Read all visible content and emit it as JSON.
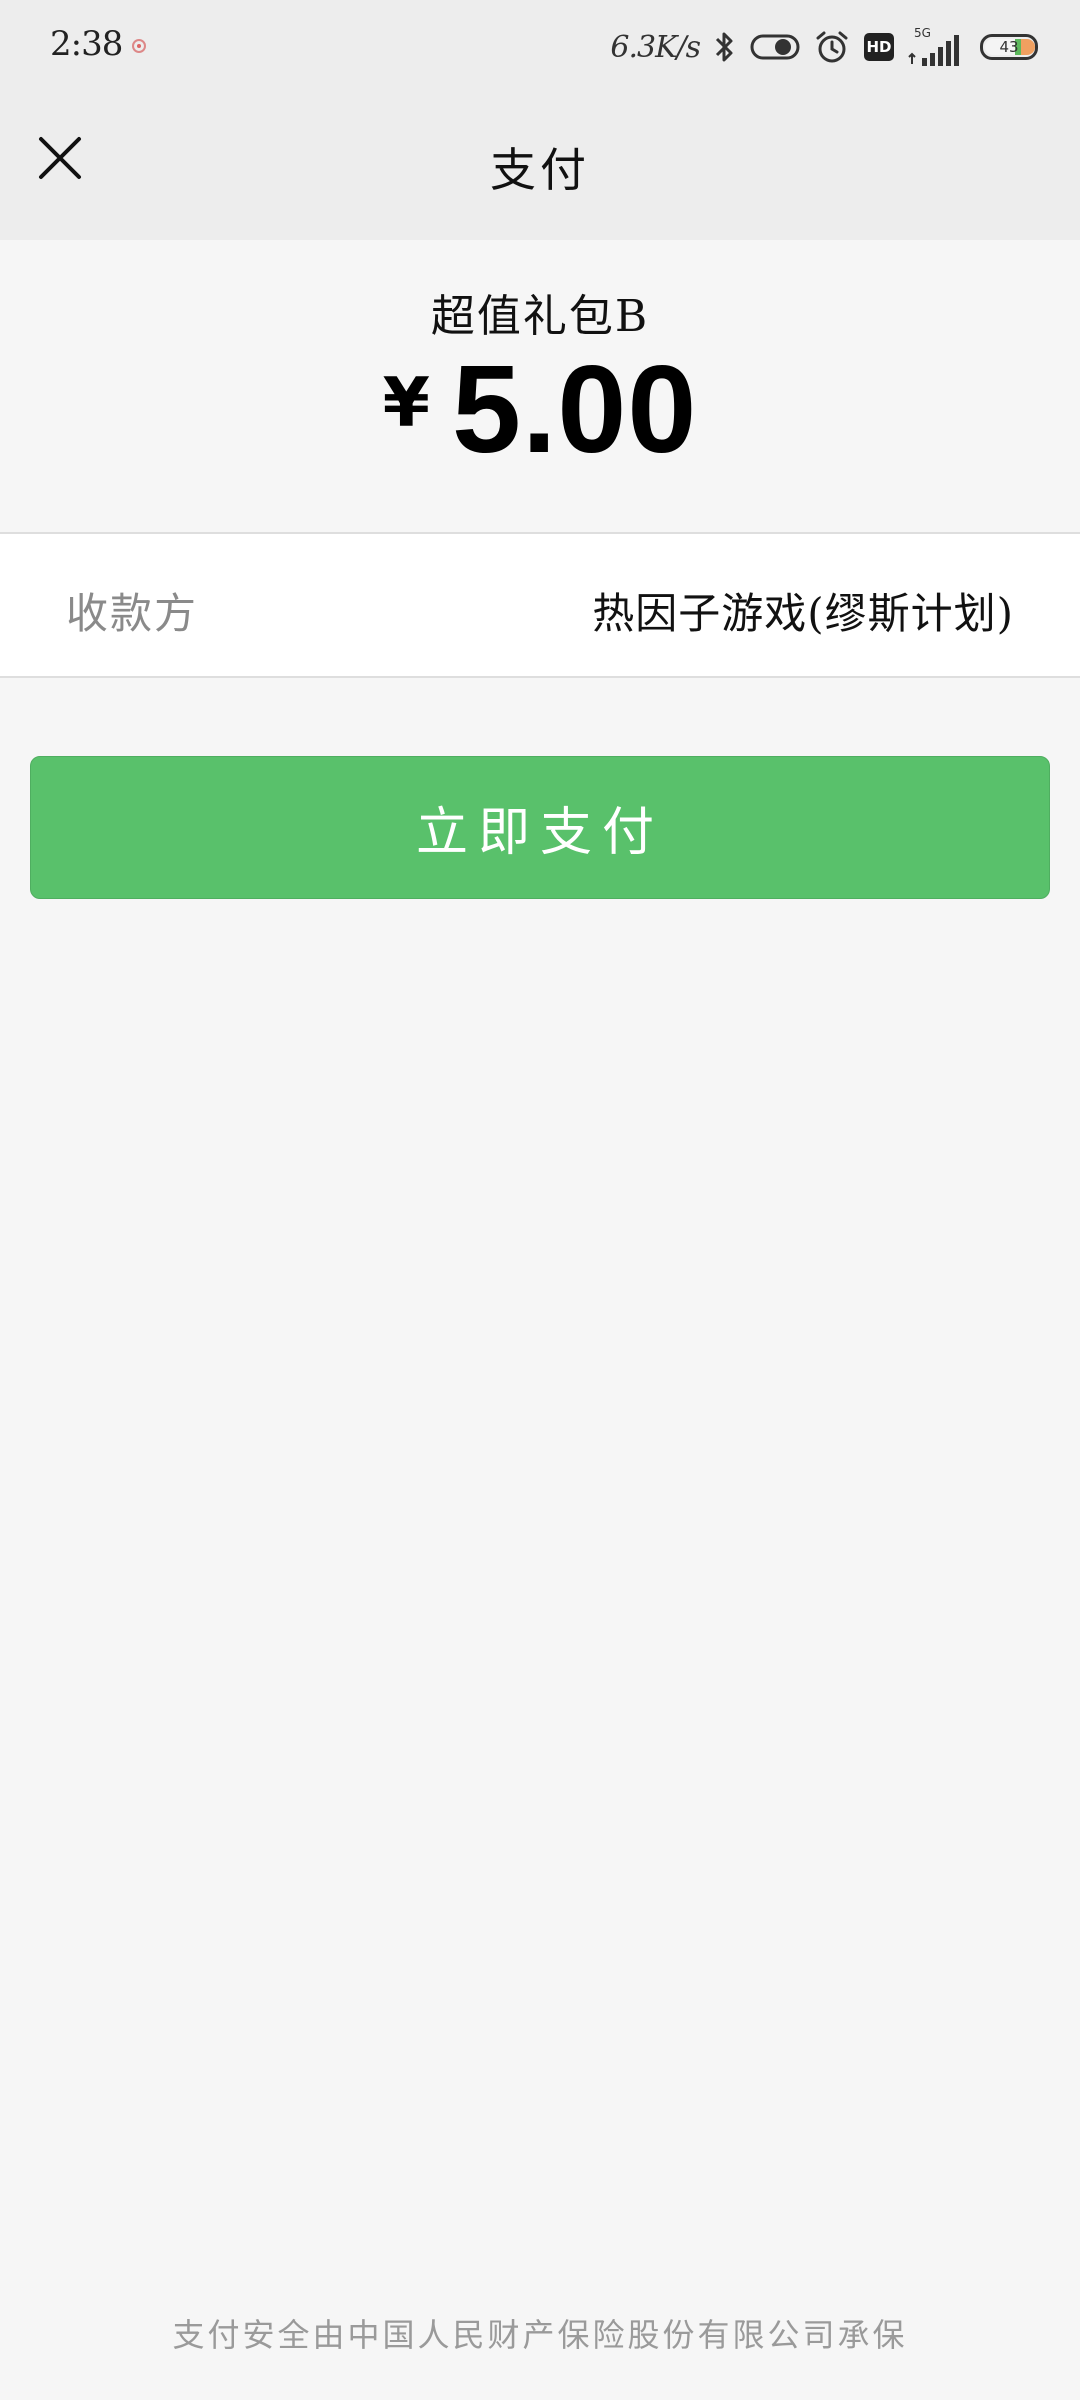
{
  "status_bar": {
    "time": "2:38",
    "net_speed": "6.3K/s",
    "hd_label": "HD",
    "network_label": "5G",
    "battery_level": "43",
    "icons": [
      "recording-dot-icon",
      "bluetooth-icon",
      "toggle-icon",
      "alarm-icon",
      "hd-icon",
      "signal-icon",
      "battery-icon"
    ]
  },
  "header": {
    "title": "支付",
    "close_icon": "close-icon"
  },
  "order": {
    "product_name": "超值礼包B",
    "currency_symbol": "¥",
    "amount": "5.00"
  },
  "payee": {
    "label": "收款方",
    "value": "热因子游戏(缪斯计划)"
  },
  "pay_button": {
    "label": "立即支付",
    "color": "#59c16b"
  },
  "footer": {
    "note": "支付安全由中国人民财产保险股份有限公司承保"
  }
}
